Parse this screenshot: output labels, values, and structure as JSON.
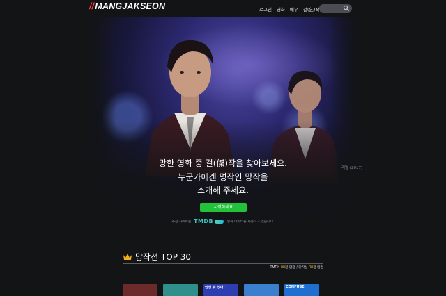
{
  "header": {
    "logo_slashes": "//",
    "logo_text": "MANGJAKSEON",
    "nav": [
      "로그인",
      "영화",
      "배우",
      "걸(乞)작선"
    ],
    "search_placeholder": ""
  },
  "hero": {
    "headline_lines": [
      "망한 영화 중 걸(傑)작을 찾아보세요.",
      "누군가에겐 명작인 망작을",
      "소개해 주세요."
    ],
    "credit": "리얼 (2017)",
    "cta_label": "시작하세요",
    "tmdb_before": "추천 사이트는",
    "tmdb_logo": "TMDB",
    "tmdb_after": "영화 데이터를 사용하고 있습니다."
  },
  "section": {
    "title": "망작선 TOP 30",
    "stats_prefix": "TMDb",
    "stats_tmdb_value": "00",
    "stats_mid": "점 만점 / 망작선",
    "stats_mang_value": "00",
    "stats_suffix": "점 만점"
  },
  "posters": [
    {
      "caption": "",
      "color": "#6b2b2b"
    },
    {
      "caption": "",
      "color": "#2f8f8a"
    },
    {
      "caption": "인생 뭐 있어!",
      "color": "#2d3fb0"
    },
    {
      "caption": "",
      "color": "#3b7fcf"
    },
    {
      "caption": "CONFUSE",
      "color": "#1f6fd1"
    }
  ],
  "colors": {
    "accent_green": "#22c23a",
    "accent_red": "#ff3b3b",
    "accent_gold": "#f2b01e",
    "background": "#121416"
  },
  "icons": {
    "search": "search-icon",
    "crown": "crown-icon"
  }
}
